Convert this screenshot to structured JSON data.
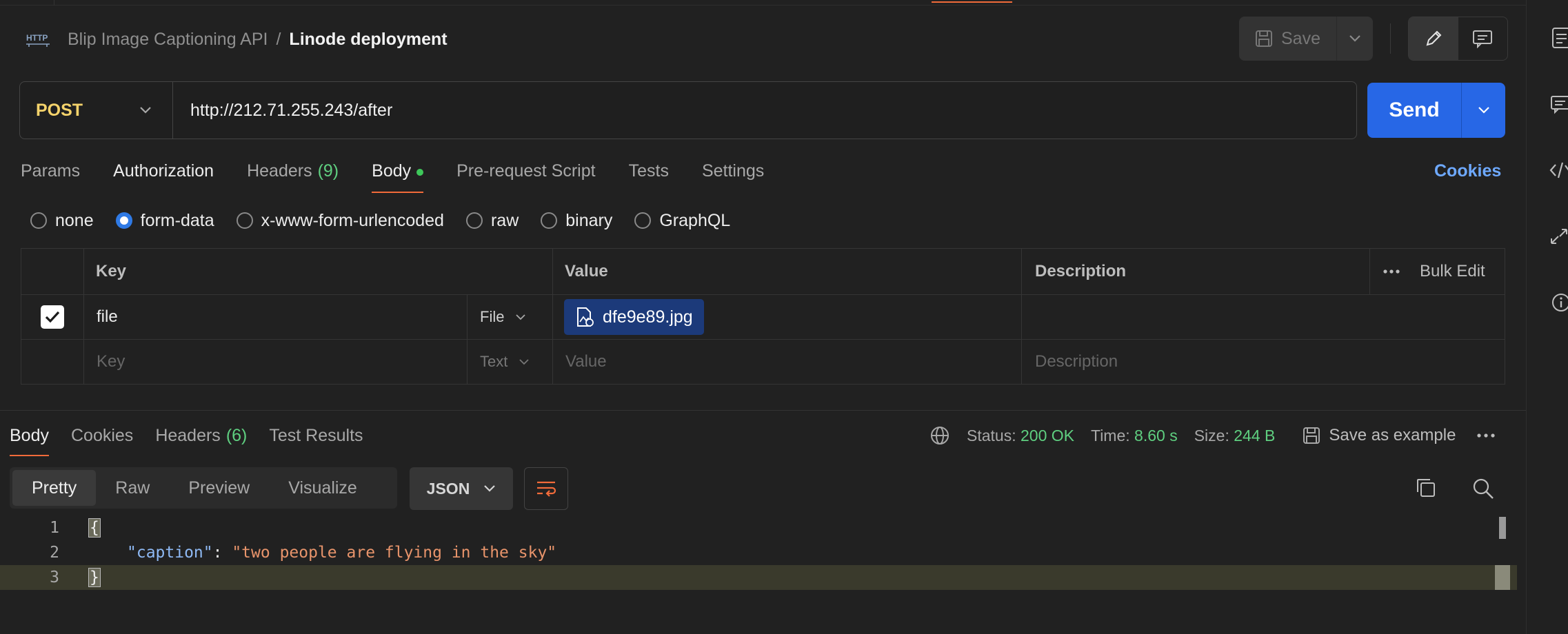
{
  "header": {
    "parent": "Blip Image Captioning API",
    "separator": "/",
    "current": "Linode deployment",
    "save_label": "Save"
  },
  "request": {
    "method": "POST",
    "url": "http://212.71.255.243/after",
    "send_label": "Send"
  },
  "request_tabs": {
    "params": "Params",
    "authorization": "Authorization",
    "headers": "Headers",
    "headers_count": "(9)",
    "body": "Body",
    "pre_request": "Pre-request Script",
    "tests": "Tests",
    "settings": "Settings",
    "cookies": "Cookies"
  },
  "body_types": {
    "none": "none",
    "form_data": "form-data",
    "urlencoded": "x-www-form-urlencoded",
    "raw": "raw",
    "binary": "binary",
    "graphql": "GraphQL",
    "selected": "form-data"
  },
  "params_table": {
    "headers": {
      "key": "Key",
      "value": "Value",
      "description": "Description",
      "bulk_edit": "Bulk Edit"
    },
    "rows": [
      {
        "key": "file",
        "type": "File",
        "value": "dfe9e89.jpg",
        "checked": true
      }
    ],
    "placeholder": {
      "key": "Key",
      "type": "Text",
      "value": "Value",
      "description": "Description"
    }
  },
  "response": {
    "tabs": {
      "body": "Body",
      "cookies": "Cookies",
      "headers": "Headers",
      "headers_count": "(6)",
      "test_results": "Test Results"
    },
    "status_label": "Status:",
    "status_value": "200 OK",
    "time_label": "Time:",
    "time_value": "8.60 s",
    "size_label": "Size:",
    "size_value": "244 B",
    "save_example": "Save as example",
    "views": {
      "pretty": "Pretty",
      "raw": "Raw",
      "preview": "Preview",
      "visualize": "Visualize"
    },
    "format": "JSON",
    "code": {
      "line1_no": "1",
      "line2_no": "2",
      "line3_no": "3",
      "open_brace": "{",
      "close_brace": "}",
      "key": "\"caption\"",
      "colon": ": ",
      "value": "\"two people are flying in the sky\""
    }
  },
  "colors": {
    "accent": "#f26b3a",
    "send": "#2767e6",
    "method": "#f5d36b",
    "status_green": "#5fcf80",
    "link": "#6ea9ff"
  }
}
